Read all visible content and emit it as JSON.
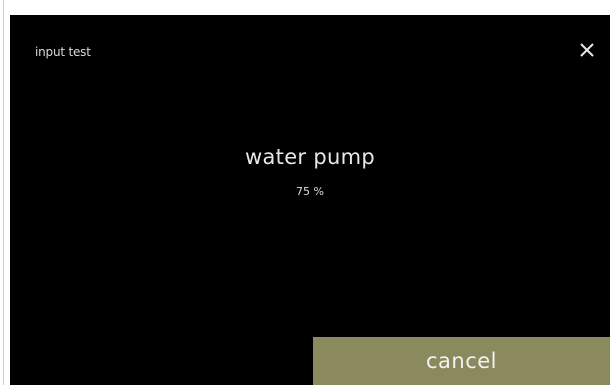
{
  "header": {
    "title": "input test",
    "close_icon": "close-icon"
  },
  "main": {
    "item_name": "water pump",
    "item_value": "75 %"
  },
  "footer": {
    "cancel_label": "cancel"
  },
  "colors": {
    "background": "#000000",
    "accent_button": "#8b8a5e",
    "text": "#e8e8e8"
  }
}
